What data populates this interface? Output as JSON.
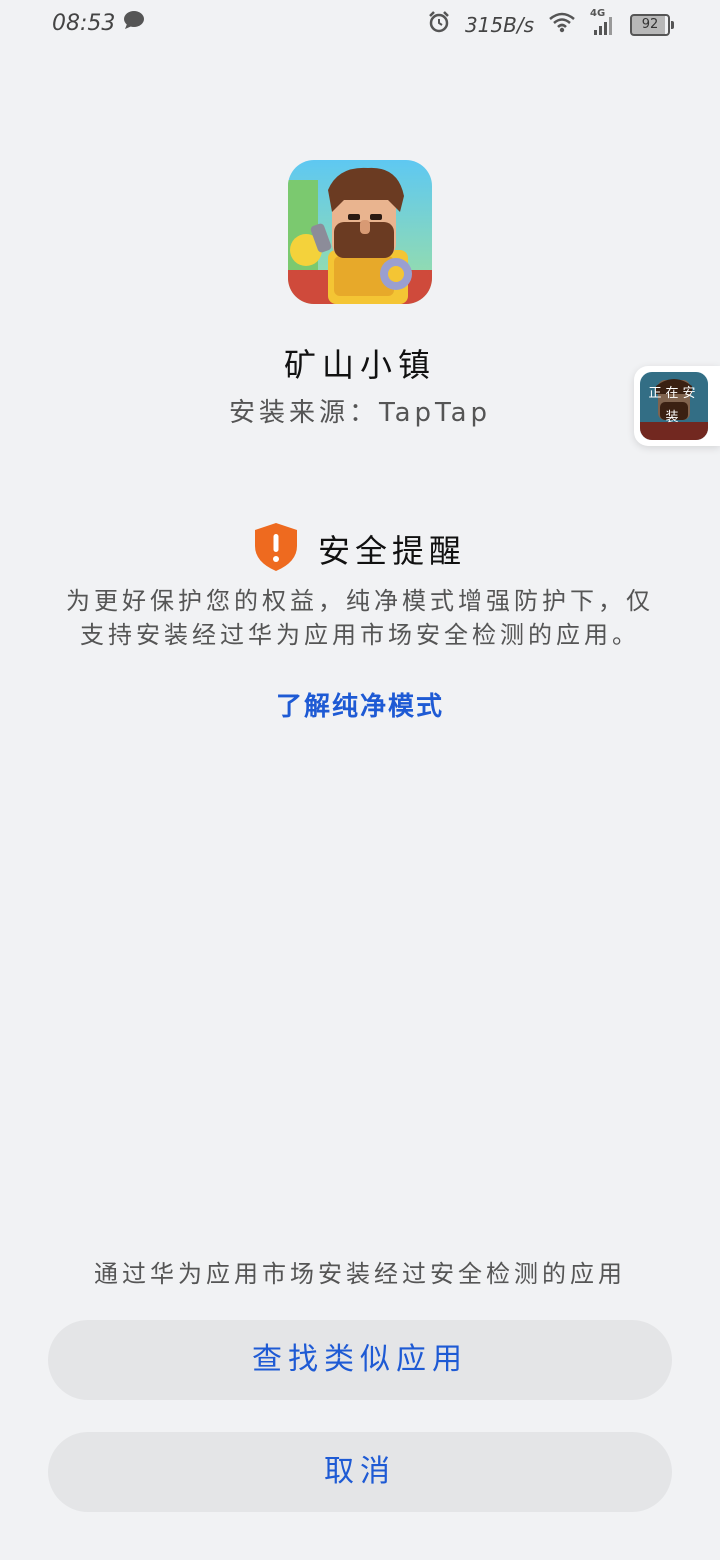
{
  "status_bar": {
    "time": "08:53",
    "net_speed": "315B/s",
    "network_type": "4G",
    "battery_level": "92"
  },
  "app": {
    "name": "矿山小镇",
    "install_source": "安装来源：TapTap"
  },
  "float_widget": {
    "label": "正在安装"
  },
  "security": {
    "title": "安全提醒",
    "description": "为更好保护您的权益，纯净模式增强防护下，仅支持安装经过华为应用市场安全检测的应用。",
    "learn_more_link": "了解纯净模式"
  },
  "bottom": {
    "note": "通过华为应用市场安装经过安全检测的应用",
    "find_similar_button": "查找类似应用",
    "cancel_button": "取消"
  },
  "colors": {
    "background": "#f1f2f4",
    "accent_blue": "#1e5ad4",
    "warning_orange": "#ee6a1f",
    "button_bg": "#e4e5e7"
  }
}
